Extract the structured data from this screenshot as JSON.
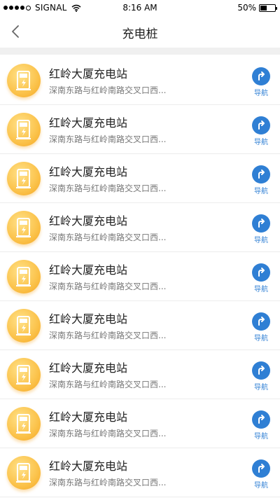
{
  "status_bar": {
    "carrier": "SIGNAL",
    "time": "8:16 AM",
    "battery": "50%",
    "battery_level": 0.5,
    "signal_bars_filled": 4
  },
  "header": {
    "title": "充电桩",
    "back_icon": "chevron-left-icon"
  },
  "stations": [
    {
      "name": "红岭大厦充电站",
      "address": "深南东路与红岭南路交叉口西...",
      "action": "导航"
    },
    {
      "name": "红岭大厦充电站",
      "address": "深南东路与红岭南路交叉口西...",
      "action": "导航"
    },
    {
      "name": "红岭大厦充电站",
      "address": "深南东路与红岭南路交叉口西...",
      "action": "导航"
    },
    {
      "name": "红岭大厦充电站",
      "address": "深南东路与红岭南路交叉口西...",
      "action": "导航"
    },
    {
      "name": "红岭大厦充电站",
      "address": "深南东路与红岭南路交叉口西...",
      "action": "导航"
    },
    {
      "name": "红岭大厦充电站",
      "address": "深南东路与红岭南路交叉口西...",
      "action": "导航"
    },
    {
      "name": "红岭大厦充电站",
      "address": "深南东路与红岭南路交叉口西...",
      "action": "导航"
    },
    {
      "name": "红岭大厦充电站",
      "address": "深南东路与红岭南路交叉口西...",
      "action": "导航"
    },
    {
      "name": "红岭大厦充电站",
      "address": "深南东路与红岭南路交叉口西...",
      "action": "导航"
    }
  ],
  "colors": {
    "accent_blue": "#2f7fd4",
    "icon_orange": "#f5a623",
    "icon_yellow": "#ffe28a"
  }
}
